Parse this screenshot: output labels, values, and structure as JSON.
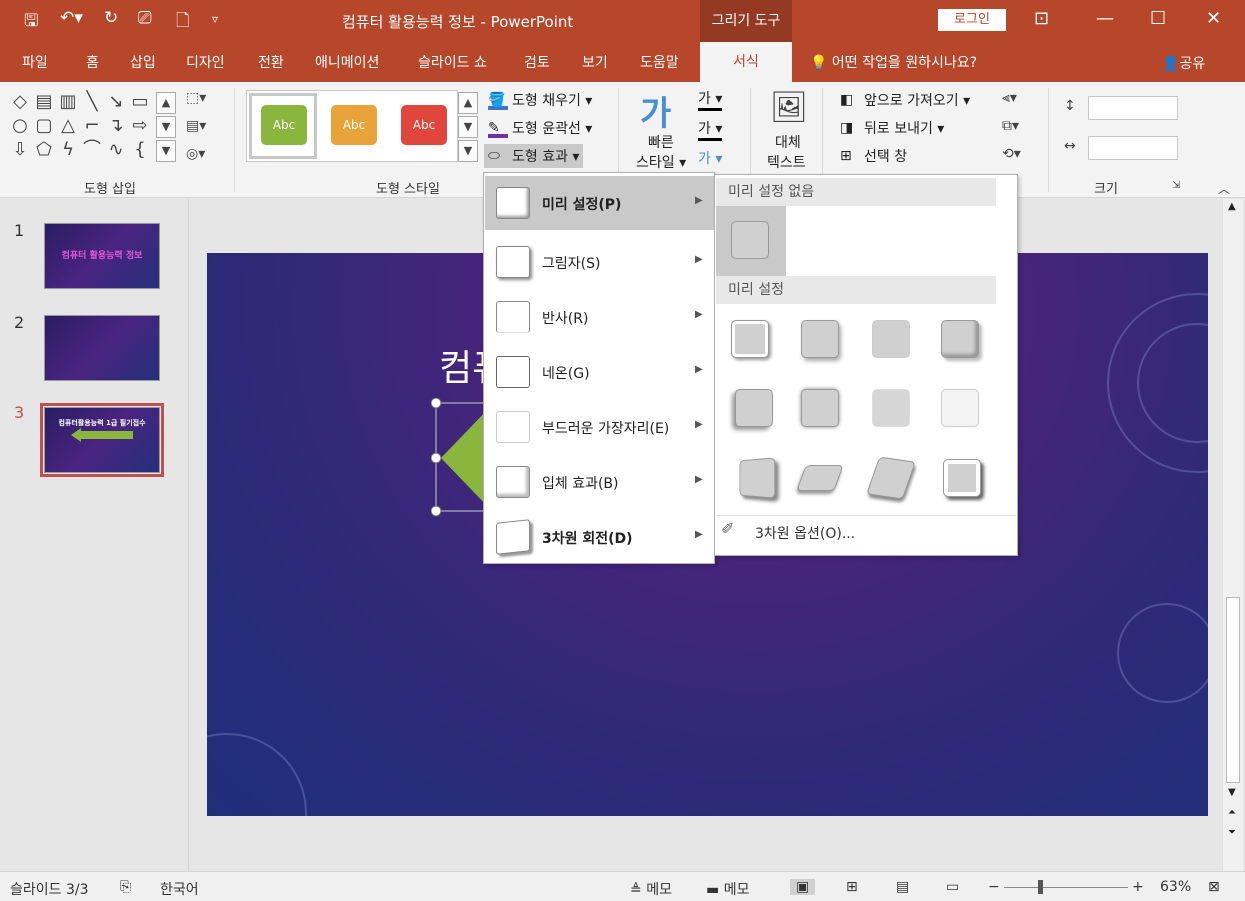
{
  "app": {
    "title": "컴퓨터 활용능력 정보  -  PowerPoint",
    "context_tools": "그리기 도구",
    "login": "로그인"
  },
  "tabs": [
    "파일",
    "홈",
    "삽입",
    "디자인",
    "전환",
    "애니메이션",
    "슬라이드 쇼",
    "검토",
    "보기",
    "도움말"
  ],
  "active_tab": "서식",
  "tell_me": "어떤 작업을 원하시나요?",
  "share": "공유",
  "ribbon": {
    "group_insert_shapes": "도형 삽입",
    "group_shape_styles": "도형 스타일",
    "group_size": "크기",
    "shape_fill": "도형 채우기",
    "shape_outline": "도형 윤곽선",
    "shape_effects": "도형 효과",
    "quick_style_1": "빠른",
    "quick_style_2": "스타일",
    "alt_text_1": "대체",
    "alt_text_2": "텍스트",
    "bring_forward": "앞으로 가져오기",
    "send_backward": "뒤로 보내기",
    "selection_pane": "선택 창",
    "style_samples": [
      "Abc",
      "Abc",
      "Abc"
    ],
    "style_colors": [
      "#8ab63e",
      "#e8a33a",
      "#e0463c"
    ],
    "wordart_char": "가"
  },
  "effects_menu": {
    "items": [
      "미리 설정(P)",
      "그림자(S)",
      "반사(R)",
      "네온(G)",
      "부드러운 가장자리(E)",
      "입체 효과(B)",
      "3차원 회전(D)"
    ]
  },
  "preset_menu": {
    "no_preset": "미리 설정 없음",
    "presets": "미리 설정",
    "three_d_options": "3차원 옵션(O)..."
  },
  "slides": {
    "numbers": [
      "1",
      "2",
      "3"
    ],
    "thumb1_title": "컴퓨터 활용능력 정보",
    "thumb3_title": "컴퓨터활용능력 1급 필기접수",
    "main_title": "컴퓨"
  },
  "status": {
    "slide_info": "슬라이드 3/3",
    "language": "한국어",
    "notes": "메모",
    "comments": "메모",
    "zoom": "63%"
  }
}
